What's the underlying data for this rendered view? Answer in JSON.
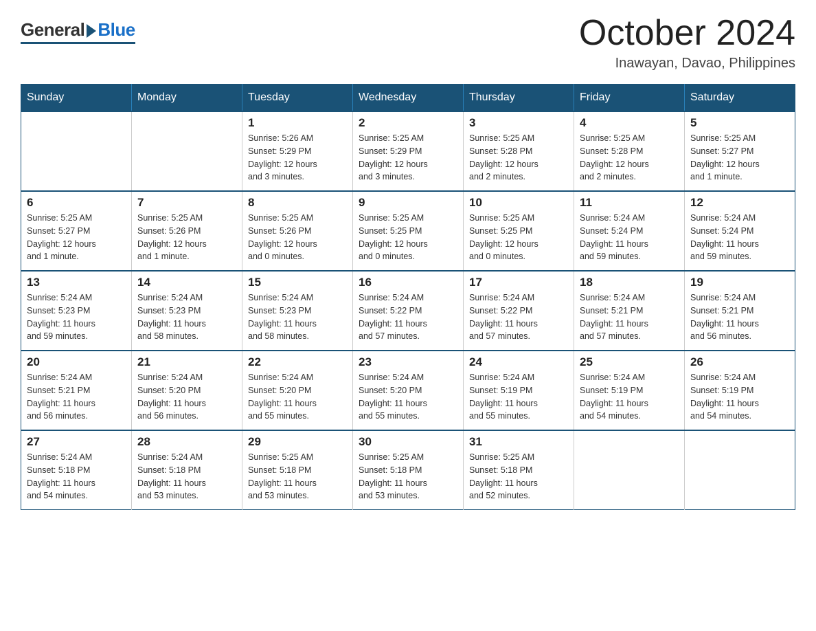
{
  "header": {
    "logo_general": "General",
    "logo_blue": "Blue",
    "month_title": "October 2024",
    "location": "Inawayan, Davao, Philippines"
  },
  "calendar": {
    "days_of_week": [
      "Sunday",
      "Monday",
      "Tuesday",
      "Wednesday",
      "Thursday",
      "Friday",
      "Saturday"
    ],
    "weeks": [
      [
        {
          "day": "",
          "info": ""
        },
        {
          "day": "",
          "info": ""
        },
        {
          "day": "1",
          "info": "Sunrise: 5:26 AM\nSunset: 5:29 PM\nDaylight: 12 hours\nand 3 minutes."
        },
        {
          "day": "2",
          "info": "Sunrise: 5:25 AM\nSunset: 5:29 PM\nDaylight: 12 hours\nand 3 minutes."
        },
        {
          "day": "3",
          "info": "Sunrise: 5:25 AM\nSunset: 5:28 PM\nDaylight: 12 hours\nand 2 minutes."
        },
        {
          "day": "4",
          "info": "Sunrise: 5:25 AM\nSunset: 5:28 PM\nDaylight: 12 hours\nand 2 minutes."
        },
        {
          "day": "5",
          "info": "Sunrise: 5:25 AM\nSunset: 5:27 PM\nDaylight: 12 hours\nand 1 minute."
        }
      ],
      [
        {
          "day": "6",
          "info": "Sunrise: 5:25 AM\nSunset: 5:27 PM\nDaylight: 12 hours\nand 1 minute."
        },
        {
          "day": "7",
          "info": "Sunrise: 5:25 AM\nSunset: 5:26 PM\nDaylight: 12 hours\nand 1 minute."
        },
        {
          "day": "8",
          "info": "Sunrise: 5:25 AM\nSunset: 5:26 PM\nDaylight: 12 hours\nand 0 minutes."
        },
        {
          "day": "9",
          "info": "Sunrise: 5:25 AM\nSunset: 5:25 PM\nDaylight: 12 hours\nand 0 minutes."
        },
        {
          "day": "10",
          "info": "Sunrise: 5:25 AM\nSunset: 5:25 PM\nDaylight: 12 hours\nand 0 minutes."
        },
        {
          "day": "11",
          "info": "Sunrise: 5:24 AM\nSunset: 5:24 PM\nDaylight: 11 hours\nand 59 minutes."
        },
        {
          "day": "12",
          "info": "Sunrise: 5:24 AM\nSunset: 5:24 PM\nDaylight: 11 hours\nand 59 minutes."
        }
      ],
      [
        {
          "day": "13",
          "info": "Sunrise: 5:24 AM\nSunset: 5:23 PM\nDaylight: 11 hours\nand 59 minutes."
        },
        {
          "day": "14",
          "info": "Sunrise: 5:24 AM\nSunset: 5:23 PM\nDaylight: 11 hours\nand 58 minutes."
        },
        {
          "day": "15",
          "info": "Sunrise: 5:24 AM\nSunset: 5:23 PM\nDaylight: 11 hours\nand 58 minutes."
        },
        {
          "day": "16",
          "info": "Sunrise: 5:24 AM\nSunset: 5:22 PM\nDaylight: 11 hours\nand 57 minutes."
        },
        {
          "day": "17",
          "info": "Sunrise: 5:24 AM\nSunset: 5:22 PM\nDaylight: 11 hours\nand 57 minutes."
        },
        {
          "day": "18",
          "info": "Sunrise: 5:24 AM\nSunset: 5:21 PM\nDaylight: 11 hours\nand 57 minutes."
        },
        {
          "day": "19",
          "info": "Sunrise: 5:24 AM\nSunset: 5:21 PM\nDaylight: 11 hours\nand 56 minutes."
        }
      ],
      [
        {
          "day": "20",
          "info": "Sunrise: 5:24 AM\nSunset: 5:21 PM\nDaylight: 11 hours\nand 56 minutes."
        },
        {
          "day": "21",
          "info": "Sunrise: 5:24 AM\nSunset: 5:20 PM\nDaylight: 11 hours\nand 56 minutes."
        },
        {
          "day": "22",
          "info": "Sunrise: 5:24 AM\nSunset: 5:20 PM\nDaylight: 11 hours\nand 55 minutes."
        },
        {
          "day": "23",
          "info": "Sunrise: 5:24 AM\nSunset: 5:20 PM\nDaylight: 11 hours\nand 55 minutes."
        },
        {
          "day": "24",
          "info": "Sunrise: 5:24 AM\nSunset: 5:19 PM\nDaylight: 11 hours\nand 55 minutes."
        },
        {
          "day": "25",
          "info": "Sunrise: 5:24 AM\nSunset: 5:19 PM\nDaylight: 11 hours\nand 54 minutes."
        },
        {
          "day": "26",
          "info": "Sunrise: 5:24 AM\nSunset: 5:19 PM\nDaylight: 11 hours\nand 54 minutes."
        }
      ],
      [
        {
          "day": "27",
          "info": "Sunrise: 5:24 AM\nSunset: 5:18 PM\nDaylight: 11 hours\nand 54 minutes."
        },
        {
          "day": "28",
          "info": "Sunrise: 5:24 AM\nSunset: 5:18 PM\nDaylight: 11 hours\nand 53 minutes."
        },
        {
          "day": "29",
          "info": "Sunrise: 5:25 AM\nSunset: 5:18 PM\nDaylight: 11 hours\nand 53 minutes."
        },
        {
          "day": "30",
          "info": "Sunrise: 5:25 AM\nSunset: 5:18 PM\nDaylight: 11 hours\nand 53 minutes."
        },
        {
          "day": "31",
          "info": "Sunrise: 5:25 AM\nSunset: 5:18 PM\nDaylight: 11 hours\nand 52 minutes."
        },
        {
          "day": "",
          "info": ""
        },
        {
          "day": "",
          "info": ""
        }
      ]
    ]
  }
}
